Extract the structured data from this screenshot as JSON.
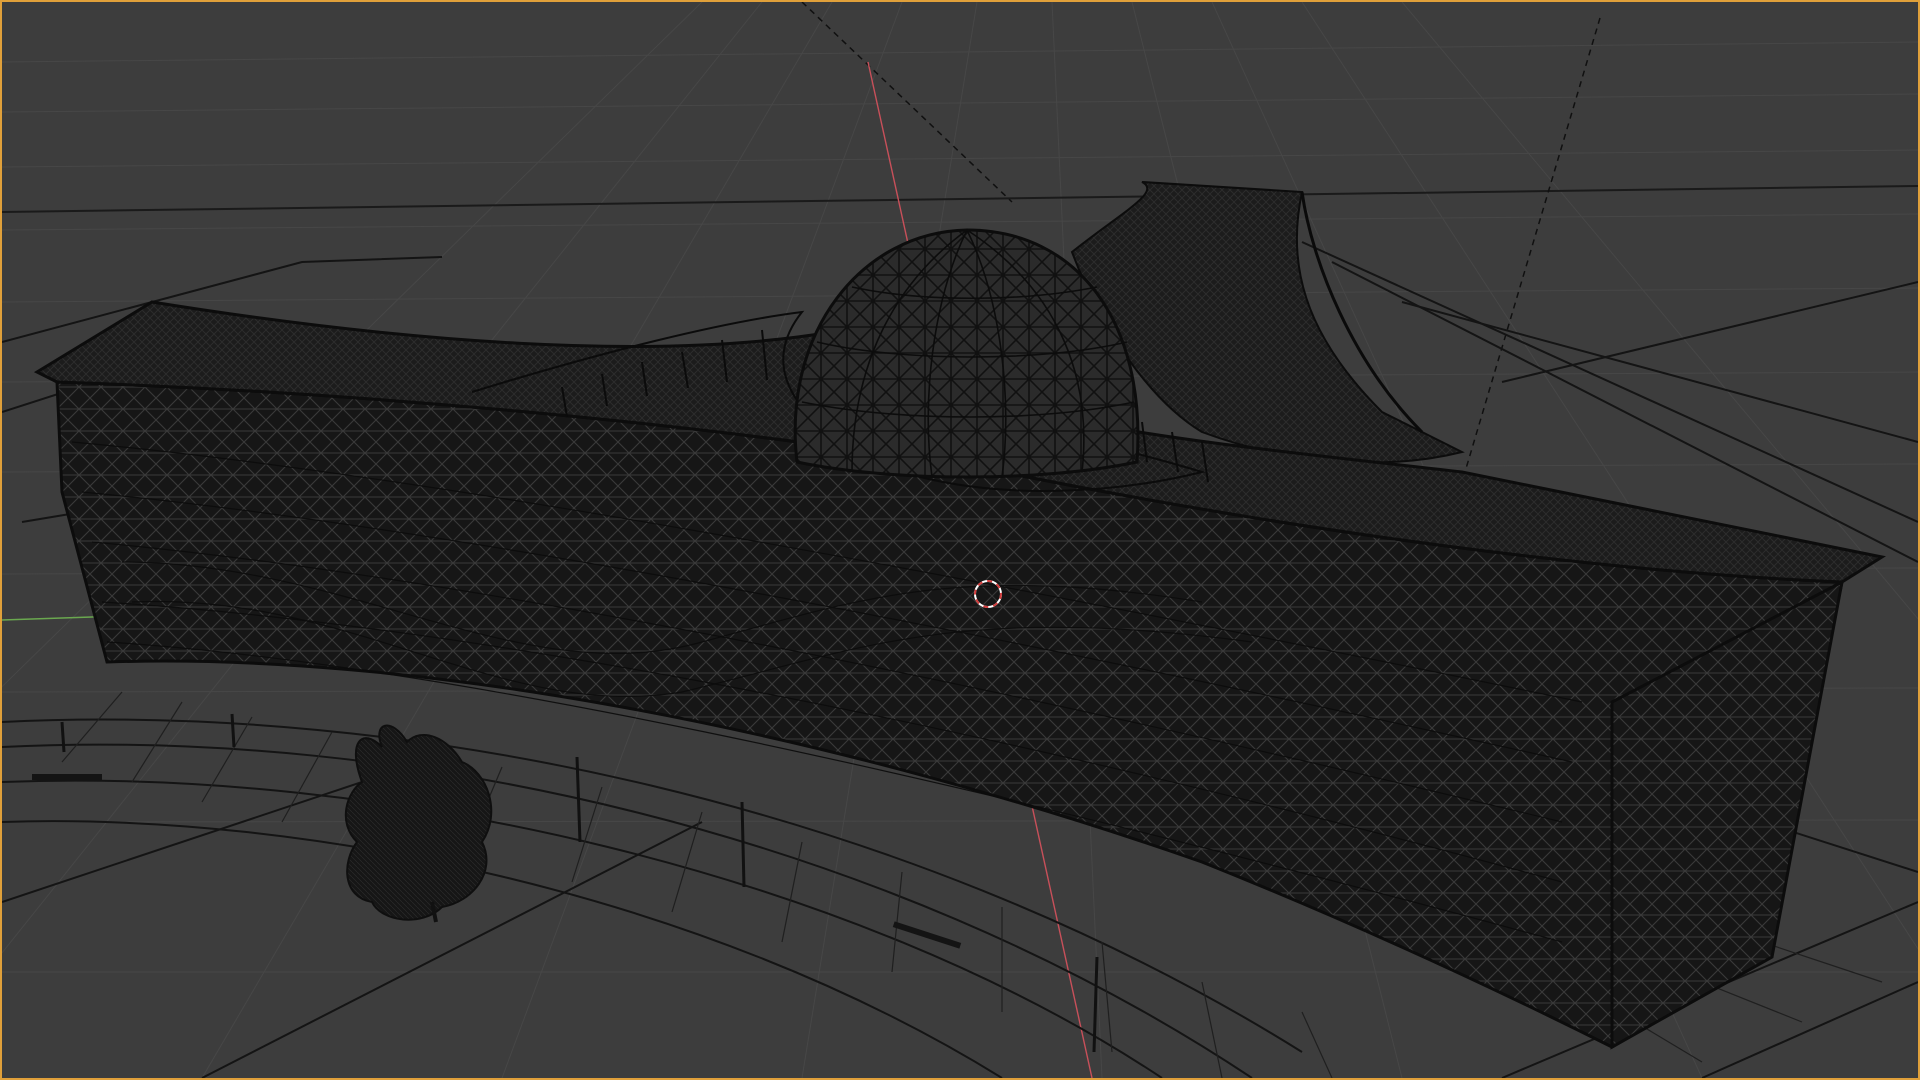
{
  "viewport": {
    "mode": "wireframe",
    "active_border_color": "#e0a03a",
    "background_color": "#3d3d3d",
    "grid_color": "#474747",
    "x_axis_color": "#c8505a",
    "y_axis_color": "#6aa84f",
    "wire_color": "#0c0c0c"
  },
  "scene": {
    "objects": [
      {
        "name": "building",
        "kind": "long curved facade building with diagrid wireframe"
      },
      {
        "name": "dome",
        "kind": "geodesic dome"
      },
      {
        "name": "roof-wing",
        "kind": "swept curved roof wing"
      },
      {
        "name": "tree",
        "kind": "tree mesh"
      },
      {
        "name": "site-plan",
        "kind": "ground plane plan lines and walkway"
      }
    ]
  },
  "icons": {
    "cursor": "3d-cursor-icon"
  }
}
